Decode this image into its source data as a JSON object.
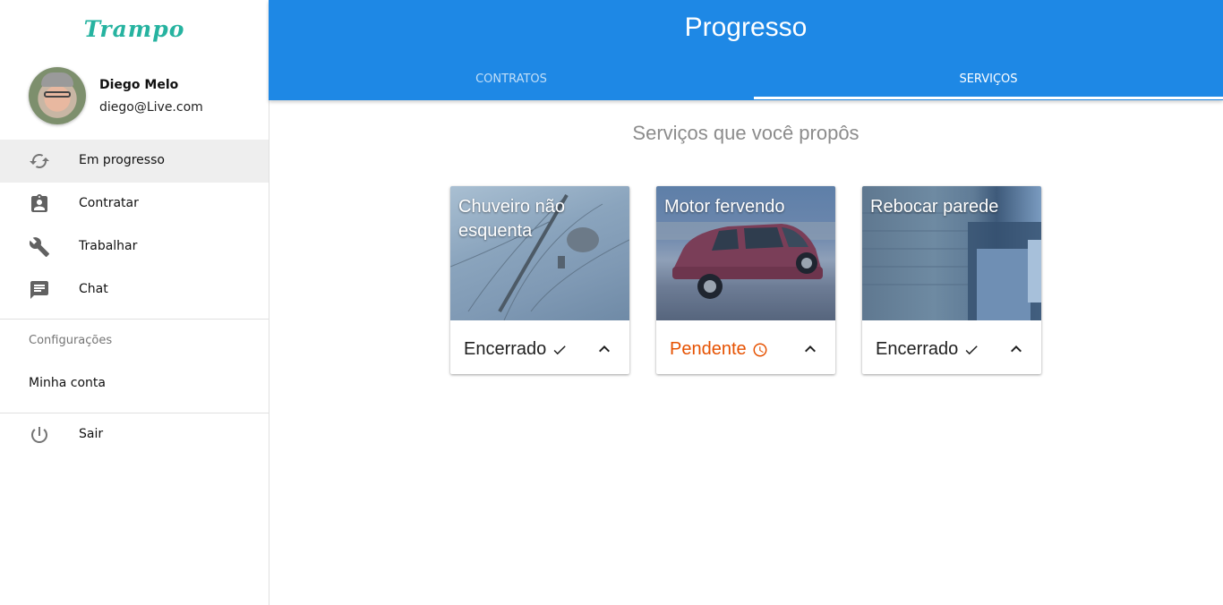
{
  "app": {
    "logo": "Trampo"
  },
  "profile": {
    "name": "Diego Melo",
    "email": "diego@Live.com"
  },
  "nav": {
    "items": [
      {
        "label": "Em progresso",
        "icon": "sync-icon",
        "active": true
      },
      {
        "label": "Contratar",
        "icon": "assignment-ind-icon",
        "active": false
      },
      {
        "label": "Trabalhar",
        "icon": "wrench-icon",
        "active": false
      },
      {
        "label": "Chat",
        "icon": "chat-icon",
        "active": false
      }
    ],
    "section_label": "Configurações",
    "account": "Minha conta",
    "logout": {
      "label": "Sair",
      "icon": "power-icon"
    }
  },
  "header": {
    "title": "Progresso",
    "tabs": [
      {
        "label": "CONTRATOS",
        "active": false
      },
      {
        "label": "SERVIÇOS",
        "active": true
      }
    ]
  },
  "main": {
    "section_title": "Serviços que você propôs",
    "cards": [
      {
        "title": "Chuveiro não esquenta",
        "status": "Encerrado",
        "status_icon": "check-icon",
        "status_color": "#212121"
      },
      {
        "title": "Motor fervendo",
        "status": "Pendente",
        "status_icon": "clock-icon",
        "status_color": "#e65100"
      },
      {
        "title": "Rebocar parede",
        "status": "Encerrado",
        "status_icon": "check-icon",
        "status_color": "#212121"
      }
    ]
  },
  "colors": {
    "primary": "#1e88e5",
    "logo": "#26b3a0",
    "pending": "#e65100"
  }
}
